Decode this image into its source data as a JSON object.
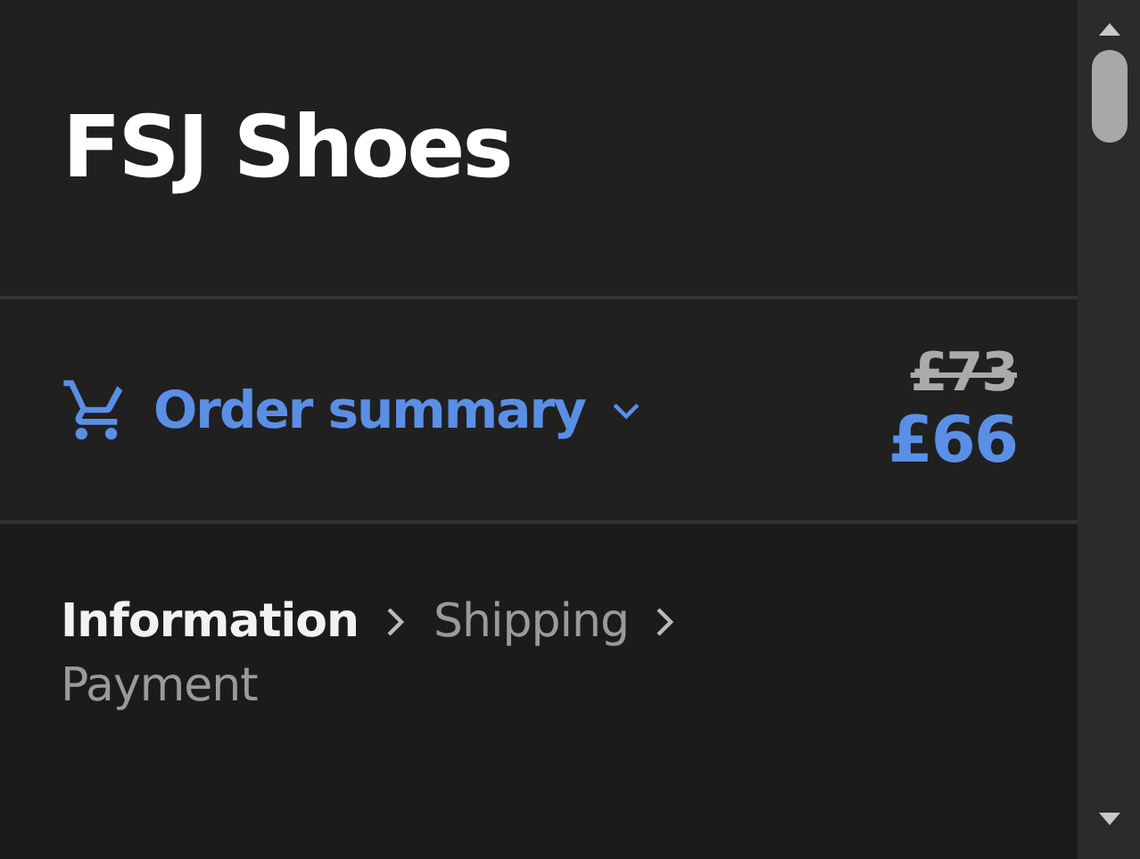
{
  "store_name": "FSJ Shoes",
  "order_summary": {
    "label": "Order summary",
    "expanded": false,
    "original_price": "£73",
    "price": "£66"
  },
  "breadcrumb": [
    {
      "label": "Information",
      "selected": true
    },
    {
      "label": "Shipping",
      "selected": false
    },
    {
      "label": "Payment",
      "selected": false
    }
  ]
}
